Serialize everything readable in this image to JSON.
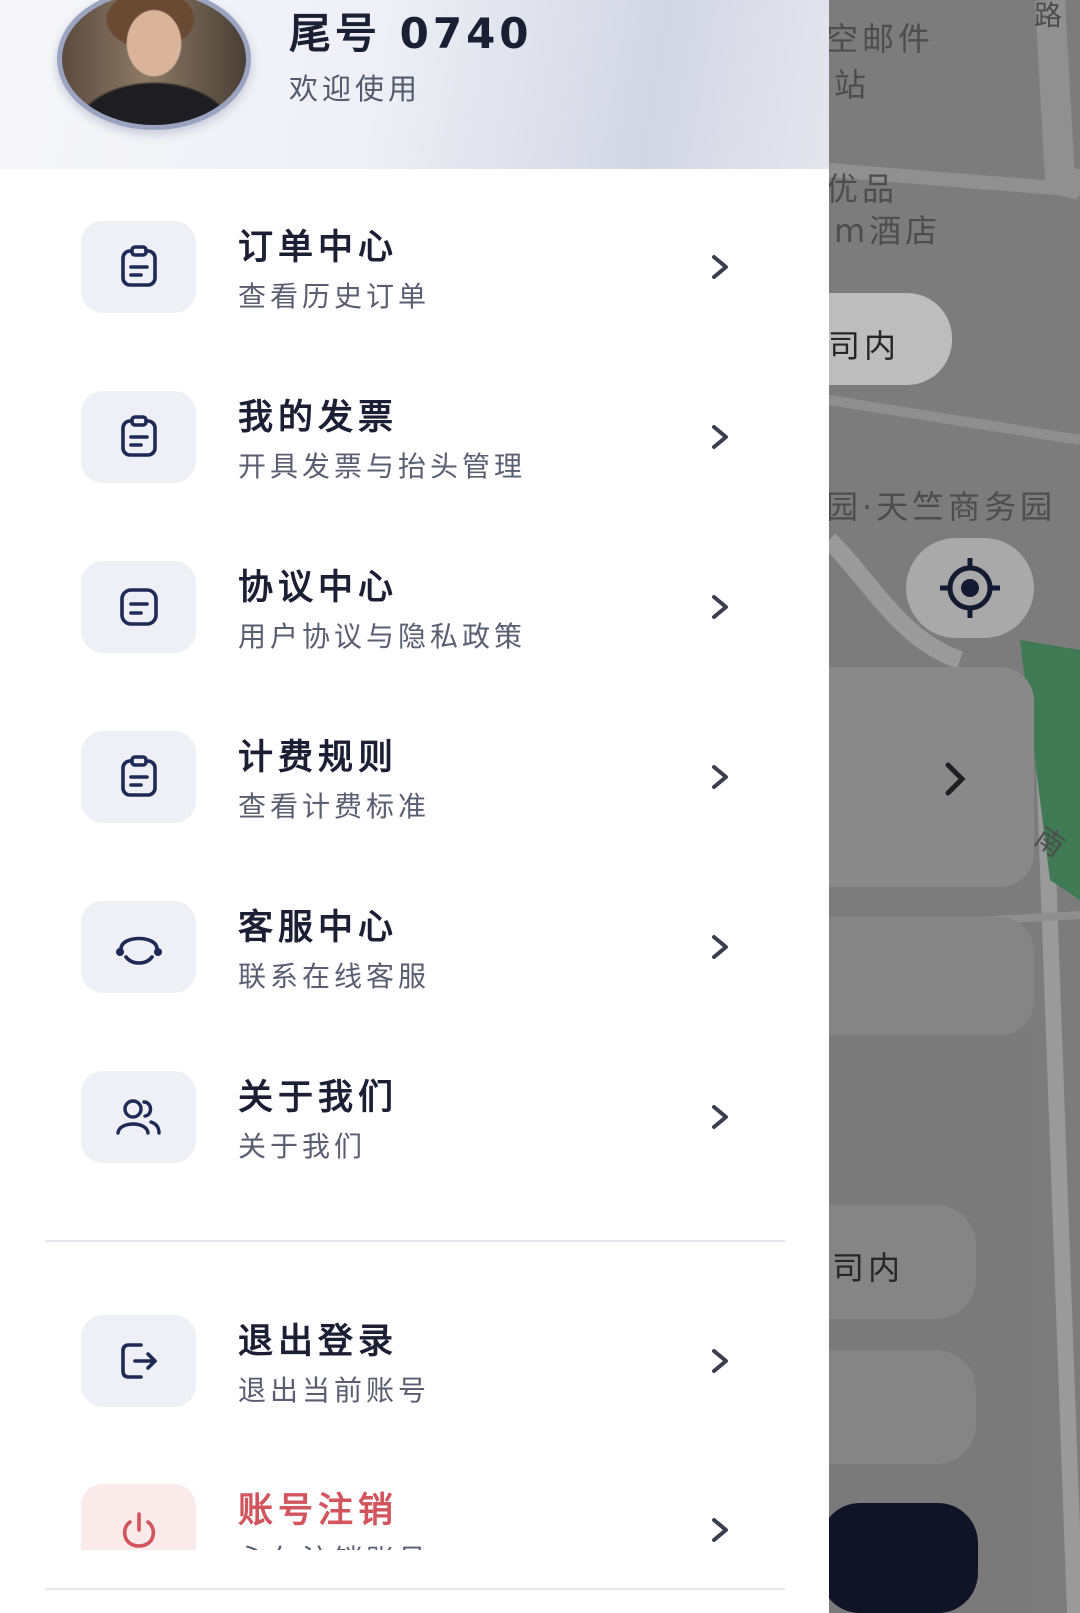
{
  "header": {
    "user_name": "尾号 0740",
    "welcome": "欢迎使用"
  },
  "menu": {
    "items": [
      {
        "title": "订单中心",
        "desc": "查看历史订单",
        "icon": "clipboard-icon"
      },
      {
        "title": "我的发票",
        "desc": "开具发票与抬头管理",
        "icon": "clipboard-icon"
      },
      {
        "title": "协议中心",
        "desc": "用户协议与隐私政策",
        "icon": "document-icon"
      },
      {
        "title": "计费规则",
        "desc": "查看计费标准",
        "icon": "clipboard-icon"
      },
      {
        "title": "客服中心",
        "desc": "联系在线客服",
        "icon": "headset-icon"
      },
      {
        "title": "关于我们",
        "desc": "关于我们",
        "icon": "users-icon"
      }
    ],
    "account": [
      {
        "title": "退出登录",
        "desc": "退出当前账号",
        "icon": "logout-icon"
      },
      {
        "title": "账号注销",
        "desc": "永久注销账号",
        "icon": "power-icon"
      }
    ]
  },
  "map": {
    "labels": [
      "空邮件",
      "站",
      "优品",
      "m酒店",
      "司内",
      "园·天竺商务园",
      "司内",
      "路",
      "南"
    ]
  },
  "colors": {
    "primary_text": "#1c1f33",
    "secondary_text": "#5a5e70",
    "icon_color": "#1e2a55",
    "icon_bg": "#eef0f5",
    "danger": "#d2545d",
    "danger_bg": "#fbeaea"
  }
}
